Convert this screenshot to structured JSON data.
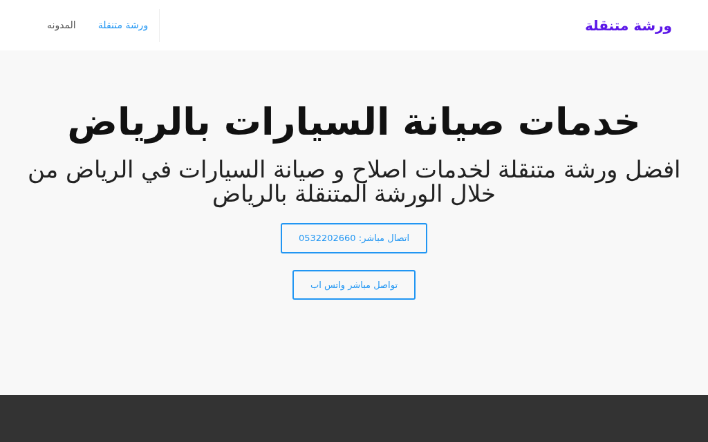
{
  "brand": "ورشة متنقلة",
  "nav": [
    {
      "label": "ورشة متنقلة",
      "selected": true
    },
    {
      "label": "المدونه",
      "selected": false
    }
  ],
  "hero": {
    "title": "خدمات صيانة السيارات بالرياض",
    "subtitle": "افضل ورشة متنقلة لخدمات اصلاح و صيانة السيارات في الرياض من خلال الورشة المتنقلة بالرياض",
    "buttons": [
      {
        "label": "اتصال مباشر: 0532202660"
      },
      {
        "label": "تواصل مباشر واتس اب"
      }
    ]
  }
}
